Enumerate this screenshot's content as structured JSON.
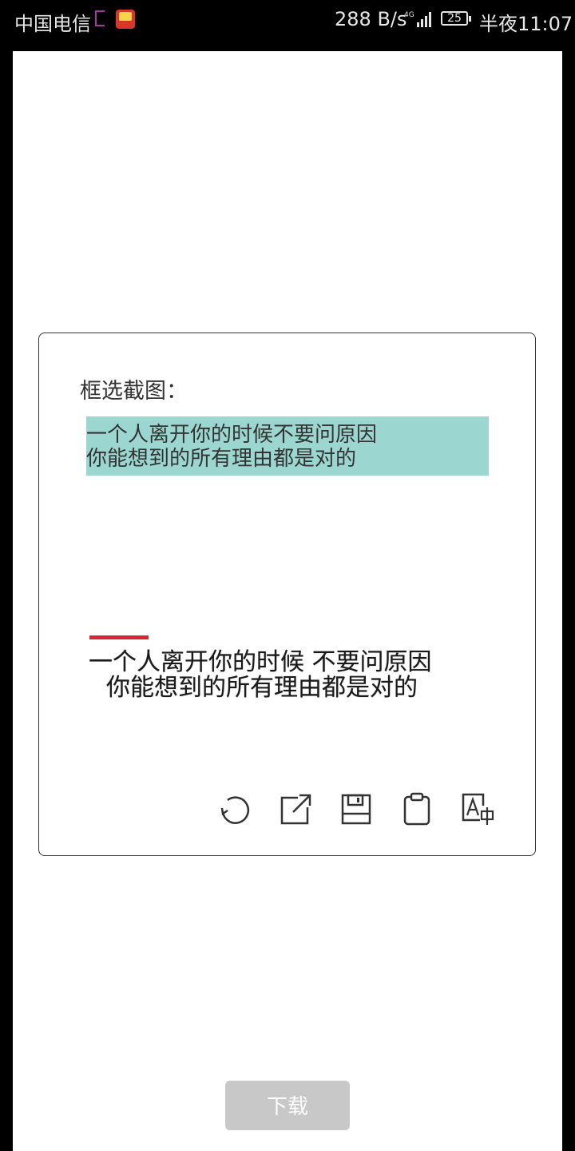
{
  "status_bar": {
    "carrier": "中国电信",
    "net_speed": "288 B/s",
    "battery": "25",
    "time": "半夜11:07"
  },
  "dialog": {
    "title": "框选截图：",
    "selected_text": {
      "line1": "一个人离开你的时候不要问原因",
      "line2": "你能想到的所有理由都是对的"
    },
    "image_text": {
      "line1": "一个人离开你的时候 不要问原因",
      "line2": "你能想到的所有理由都是对的"
    },
    "toolbar_icons": [
      "refresh-icon",
      "share-icon",
      "save-icon",
      "clipboard-icon",
      "translate-icon"
    ]
  },
  "download_button": {
    "label": "下载"
  },
  "colors": {
    "selection_highlight": "#9bd7d0",
    "accent_red": "#d8262c",
    "button_disabled": "#c8c8c8"
  }
}
